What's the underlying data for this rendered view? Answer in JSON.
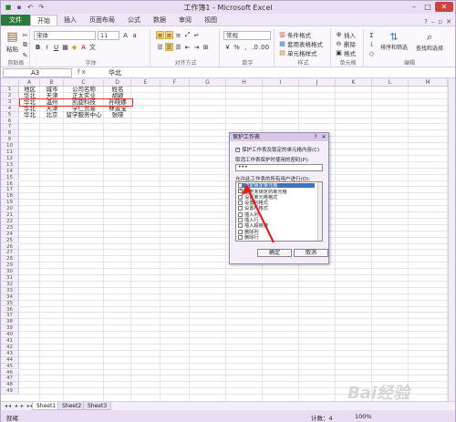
{
  "window": {
    "title": "工作簿1 - Microsoft Excel"
  },
  "qat": {
    "icons": [
      "excel-icon",
      "save-icon",
      "undo-icon",
      "redo-icon"
    ]
  },
  "ribbon_tabs": [
    "文件",
    "开始",
    "插入",
    "页面布局",
    "公式",
    "数据",
    "审阅",
    "视图"
  ],
  "ribbon": {
    "paste": "粘贴",
    "clipboard": "剪贴板",
    "font_name": "宋体",
    "font_size": "11",
    "font_group": "字体",
    "align_group": "对齐方式",
    "number_format": "常规",
    "number_group": "数字",
    "cond_format": "条件格式",
    "table_format": "套用表格格式",
    "cell_style": "单元格样式",
    "style_group": "样式",
    "insert": "插入",
    "delete": "删除",
    "format": "格式",
    "cells_group": "单元格",
    "sort_filter": "排序和筛选",
    "find_select": "查找和选择",
    "edit_group": "编辑"
  },
  "formula_bar": {
    "name_box": "A3",
    "fx": "fx",
    "value": "华北"
  },
  "columns": [
    "A",
    "B",
    "C",
    "D",
    "E",
    "F",
    "G",
    "H",
    "I",
    "J",
    "K",
    "L",
    "M"
  ],
  "rows": [
    "1",
    "2",
    "3",
    "4",
    "5",
    "6",
    "7",
    "8",
    "9",
    "10",
    "11",
    "12",
    "13",
    "14",
    "15",
    "16",
    "17",
    "18",
    "19",
    "20",
    "21",
    "22",
    "23",
    "24",
    "25",
    "26",
    "27",
    "28",
    "29",
    "30",
    "31",
    "32",
    "33",
    "34",
    "35",
    "36",
    "37",
    "38",
    "39",
    "40",
    "41",
    "42",
    "43",
    "44",
    "45",
    "46",
    "47",
    "48",
    "49"
  ],
  "cells": [
    [
      "地区",
      "城市",
      "公司名称",
      "姓名"
    ],
    [
      "华北",
      "天津",
      "正太实业",
      "胡颖"
    ],
    [
      "华北",
      "温州",
      "凯旋科技",
      "孙晓娜"
    ],
    [
      "华北",
      "天津",
      "学仁贸易",
      "林道宝"
    ],
    [
      "华北",
      "北京",
      "留学服务中心",
      "张晓"
    ]
  ],
  "sheets": [
    "Sheet1",
    "Sheet2",
    "Sheet3"
  ],
  "status": {
    "ready": "就绪",
    "count": "计数：4",
    "zoom": "100%"
  },
  "dialog": {
    "title": "保护工作表",
    "protect_check": "保护工作表及锁定的单元格内容(C)",
    "pw_label": "取消工作表保护时使用的密码(P):",
    "pw_value": "•••",
    "allow_label": "允许此工作表的所有用户进行(O):",
    "options": [
      "选定锁定单元格",
      "选定未锁定的单元格",
      "设置单元格格式",
      "设置列格式",
      "设置行格式",
      "插入列",
      "插入行",
      "插入超链接",
      "删除列",
      "删除行"
    ],
    "ok": "确定",
    "cancel": "取消"
  },
  "watermark": "Bai经验"
}
